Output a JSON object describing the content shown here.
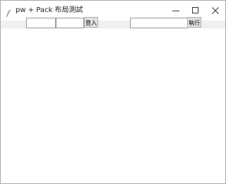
{
  "window": {
    "title": "pw + Pack 布局測試",
    "app_icon": "feather-icon",
    "controls": {
      "minimize": "minimize-icon",
      "maximize": "maximize-icon",
      "close": "close-icon"
    }
  },
  "form": {
    "entry1_value": "",
    "entry2_value": "",
    "login_label": "登入",
    "command_value": "",
    "run_label": "執行"
  }
}
